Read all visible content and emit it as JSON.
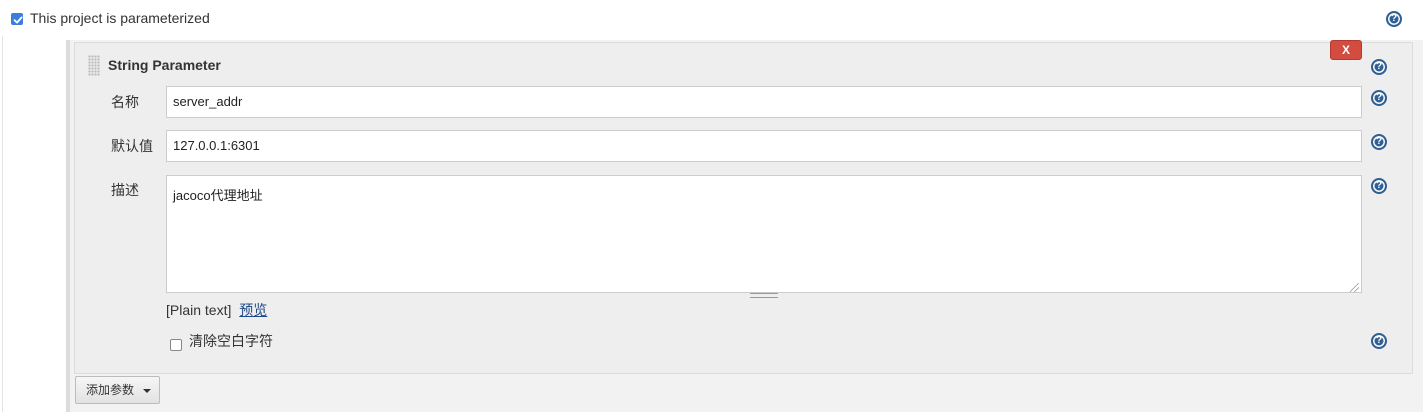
{
  "parameterized": {
    "checked": true,
    "label": "This project is parameterized"
  },
  "parameter": {
    "title": "String Parameter",
    "delete_label": "X",
    "name_label": "名称",
    "name_value": "server_addr",
    "default_label": "默认值",
    "default_value": "127.0.0.1:6301",
    "description_label": "描述",
    "description_value": "jacoco代理地址",
    "format_prefix": "[Plain text]",
    "preview_link": "预览",
    "trim_checked": false,
    "trim_label": "清除空白字符"
  },
  "add_parameter_label": "添加参数",
  "help_glyph": "?",
  "colors": {
    "accent": "#3b7ddd",
    "danger": "#d24c3f",
    "help": "#2f5f93",
    "link": "#204a87"
  }
}
